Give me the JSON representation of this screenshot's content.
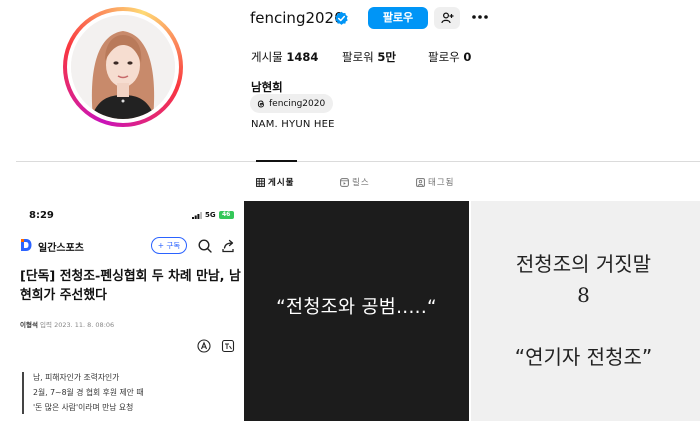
{
  "profile": {
    "username": "fencing2020",
    "follow_label": "팔로우",
    "stats": {
      "posts_label": "게시물",
      "posts_value": "1484",
      "followers_label": "팔로워",
      "followers_value": "5만",
      "following_label": "팔로우",
      "following_value": "0"
    },
    "display_name": "남현희",
    "threads_handle": "fencing2020",
    "bio": "NAM. HYUN HEE"
  },
  "tabs": {
    "posts": "게시물",
    "reels": "릴스",
    "tagged": "태그됨"
  },
  "posts": {
    "news": {
      "time": "8:29",
      "network": "5G",
      "battery": "46",
      "brand": "일간스포츠",
      "subscribe": "+ 구독",
      "headline": "[단독] 전청조-펜싱협회 두 차례 만남, 남현희가 주선했다",
      "author": "이형석",
      "date_label": "입력",
      "date": "2023. 11. 8. 08:06",
      "quote_line1": "남, 피해자인가 조력자인가",
      "quote_line2": "2월, 7~8월 경 협회 후원 제안 때",
      "quote_line3": "'돈 많은 사람'이라며 만남 요청"
    },
    "dark": {
      "text": "“전청조와 공범.....“"
    },
    "light": {
      "line1": "전청조의 거짓말",
      "line2": "8",
      "line3": "“연기자 전청조”"
    }
  },
  "colors": {
    "follow_button": "#0095f6",
    "verified_badge": "#0095f6",
    "subscribe_accent": "#2b63ff",
    "brand_logo": "#2b63ff",
    "dark_post_bg": "#1c1c1c",
    "light_post_bg": "#f0f0f0",
    "battery": "#34c759"
  }
}
